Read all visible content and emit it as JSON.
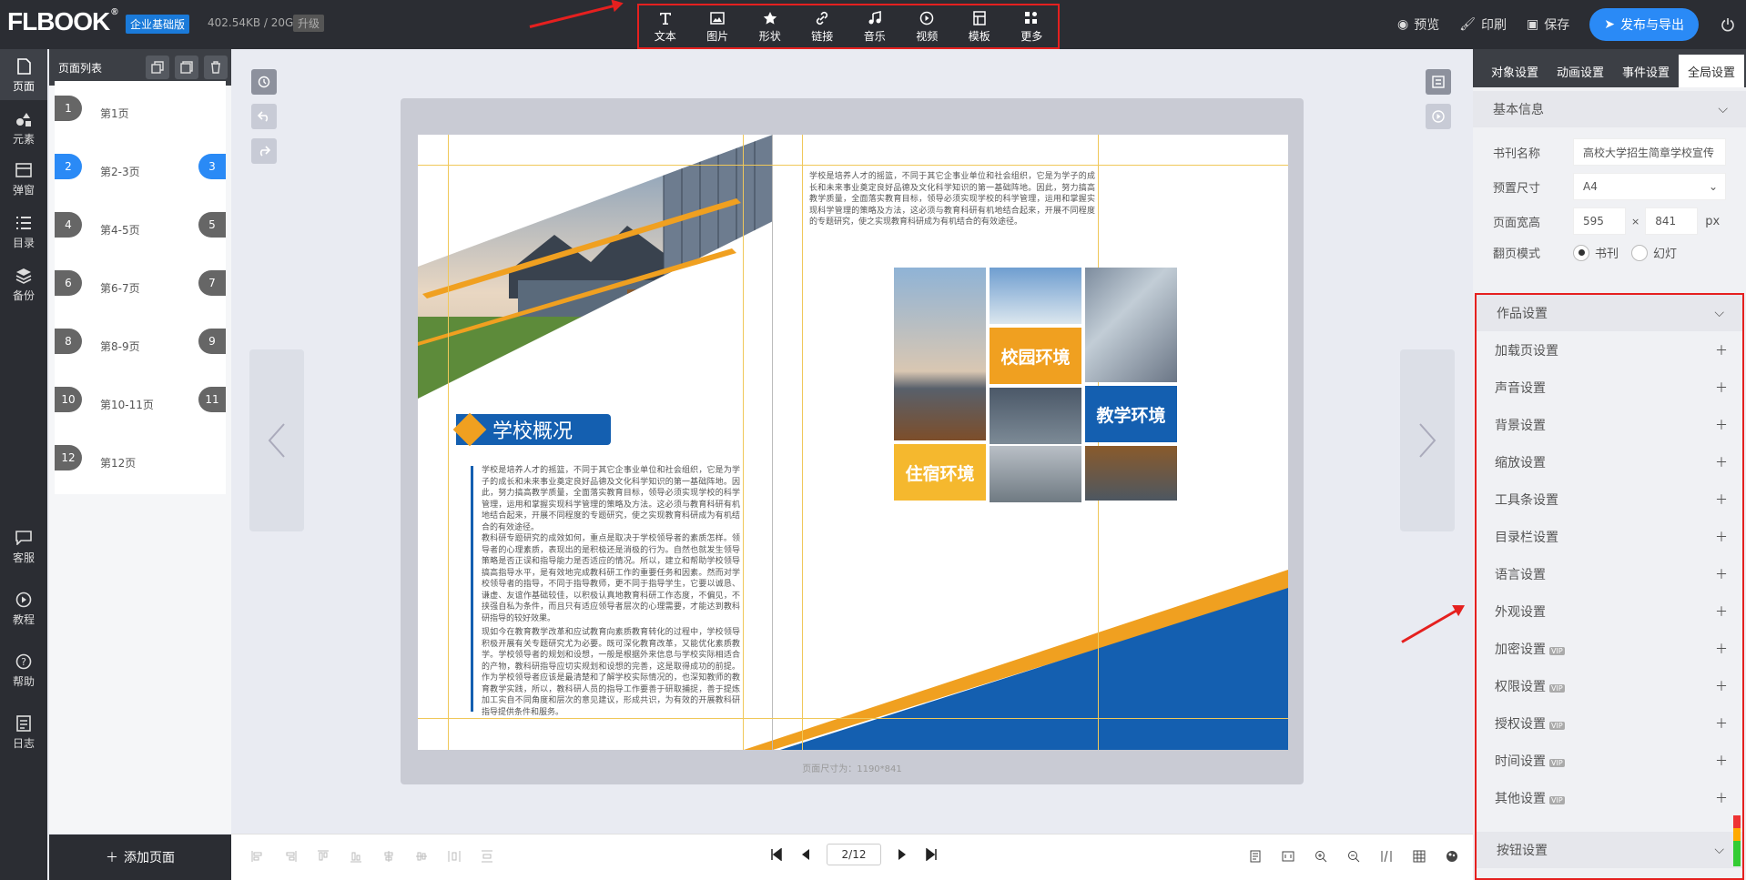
{
  "topbar": {
    "logo": "FLBOOK",
    "logo_sup": "®",
    "edition": "企业基础版",
    "storage": "402.54KB / 20G",
    "upgrade": "升级",
    "tools": [
      {
        "label": "文本",
        "icon": "text-icon"
      },
      {
        "label": "图片",
        "icon": "image-icon"
      },
      {
        "label": "形状",
        "icon": "star-icon"
      },
      {
        "label": "链接",
        "icon": "link-icon"
      },
      {
        "label": "音乐",
        "icon": "music-icon"
      },
      {
        "label": "视频",
        "icon": "video-icon"
      },
      {
        "label": "模板",
        "icon": "template-icon"
      },
      {
        "label": "更多",
        "icon": "more-icon"
      }
    ],
    "preview": "预览",
    "print": "印刷",
    "save": "保存",
    "publish": "发布与导出"
  },
  "leftnav": [
    {
      "label": "页面",
      "icon": "page-icon"
    },
    {
      "label": "元素",
      "icon": "elements-icon"
    },
    {
      "label": "弹窗",
      "icon": "popup-icon"
    },
    {
      "label": "目录",
      "icon": "toc-icon"
    },
    {
      "label": "备份",
      "icon": "backup-icon"
    },
    {
      "label": "客服",
      "icon": "chat-icon"
    },
    {
      "label": "教程",
      "icon": "play-icon"
    },
    {
      "label": "帮助",
      "icon": "help-icon"
    },
    {
      "label": "日志",
      "icon": "log-icon"
    }
  ],
  "pagelist": {
    "title": "页面列表",
    "items": [
      {
        "num": "1",
        "num2": "",
        "label": "第1页"
      },
      {
        "num": "2",
        "num2": "3",
        "label": "第2-3页"
      },
      {
        "num": "4",
        "num2": "5",
        "label": "第4-5页"
      },
      {
        "num": "6",
        "num2": "7",
        "label": "第6-7页"
      },
      {
        "num": "8",
        "num2": "9",
        "label": "第8-9页"
      },
      {
        "num": "10",
        "num2": "11",
        "label": "第10-11页"
      },
      {
        "num": "12",
        "num2": "",
        "label": "第12页"
      }
    ],
    "add": "添加页面"
  },
  "spread": {
    "title": "学校概况",
    "right_para": "学校是培养人才的摇篮，不同于其它企事业单位和社会组织，它是为学子的成长和未来事业奠定良好品德及文化科学知识的第一基础阵地。因此，努力搞高教学质量，全面落实教育目标，领导必须实现学校的科学管理，运用和掌握实现科学管理的策略及方法，这必须与教育科研有机地结合起来，开展不同程度的专题研究，使之实现教育科研成为有机结合的有效途径。",
    "left_para1": "学校是培养人才的摇篮，不同于其它企事业单位和社会组织，它是为学子的成长和未来事业奠定良好品德及文化科学知识的第一基础阵地。因此，努力搞高教学质量，全面落实教育目标，领导必须实现学校的科学管理，运用和掌握实现科学管理的策略及方法。这必须与教育科研有机地结合起来，开展不同程度的专题研究，使之实现教育科研成为有机结合的有效途径。",
    "left_para2": "教科研专题研究的成效如何，重点是取决于学校领导者的素质怎样。领导者的心理素质，表现出的是积极还是消极的行为。自然也就发生领导策略是否正误和指导能力是否适应的情况。所以，建立和帮助学校领导搞高指导水平，是有效地完成教科研工作的重要任务和因素。然而对学校领导者的指导，不同于指导教师，更不同于指导学生，它要以诚恳、谦虚、友谊作基础较佳，以积极认真地教育科研工作态度，不偏见，不挟强自私为条件，而且只有适应领导者层次的心理需要，才能达到教科研指导的较好效果。",
    "left_para3": "现如今在教育教学改革和应试教育向素质教育转化的过程中，学校领导积极开展有关专题研究尤为必要。既可深化教育改革，又能优化素质教学。学校领导者的规划和设想，一般是根据外来信息与学校实际相适合的产物，教科研指导应切实规划和设想的完善，这是取得成功的前提。作为学校领导者应该是最清楚和了解学校实际情况的，也深知教师的教育教学实践，所以，教科研人员的指导工作要善于研取捕捉，善于提炼加工实自不同角度和层次的意见建议，形成共识，为有效的开展教科研指导提供条件和服务。",
    "cells": [
      {
        "label": "校园环境"
      },
      {
        "label": "教学环境"
      },
      {
        "label": "住宿环境"
      }
    ],
    "page_size": "页面尺寸为：1190*841"
  },
  "rightpanel": {
    "tabs": [
      "对象设置",
      "动画设置",
      "事件设置",
      "全局设置"
    ],
    "basic_head": "基本信息",
    "fields": {
      "name_label": "书刊名称",
      "name_value": "高校大学招生简章学校宣传",
      "preset_label": "预置尺寸",
      "preset_value": "A4",
      "size_label": "页面宽高",
      "width": "595",
      "times": "×",
      "height": "841",
      "unit": "px",
      "flip_label": "翻页模式",
      "flip_opt1": "书刊",
      "flip_opt2": "幻灯"
    },
    "works_head": "作品设置",
    "settings": [
      {
        "label": "加载页设置",
        "vip": ""
      },
      {
        "label": "声音设置",
        "vip": ""
      },
      {
        "label": "背景设置",
        "vip": ""
      },
      {
        "label": "缩放设置",
        "vip": ""
      },
      {
        "label": "工具条设置",
        "vip": ""
      },
      {
        "label": "目录栏设置",
        "vip": ""
      },
      {
        "label": "语言设置",
        "vip": ""
      },
      {
        "label": "外观设置",
        "vip": ""
      },
      {
        "label": "加密设置",
        "vip": "VIP"
      },
      {
        "label": "权限设置",
        "vip": "VIP"
      },
      {
        "label": "授权设置",
        "vip": "VIP"
      },
      {
        "label": "时间设置",
        "vip": "VIP"
      },
      {
        "label": "其他设置",
        "vip": "VIP"
      }
    ],
    "button_head": "按钮设置"
  },
  "pager": {
    "current": "2/12"
  },
  "colors": {
    "accent": "#2a8af6",
    "orange": "#f0a020",
    "blue": "#145fb0",
    "dark": "#2b2d33",
    "highlight": "#e5201f"
  }
}
